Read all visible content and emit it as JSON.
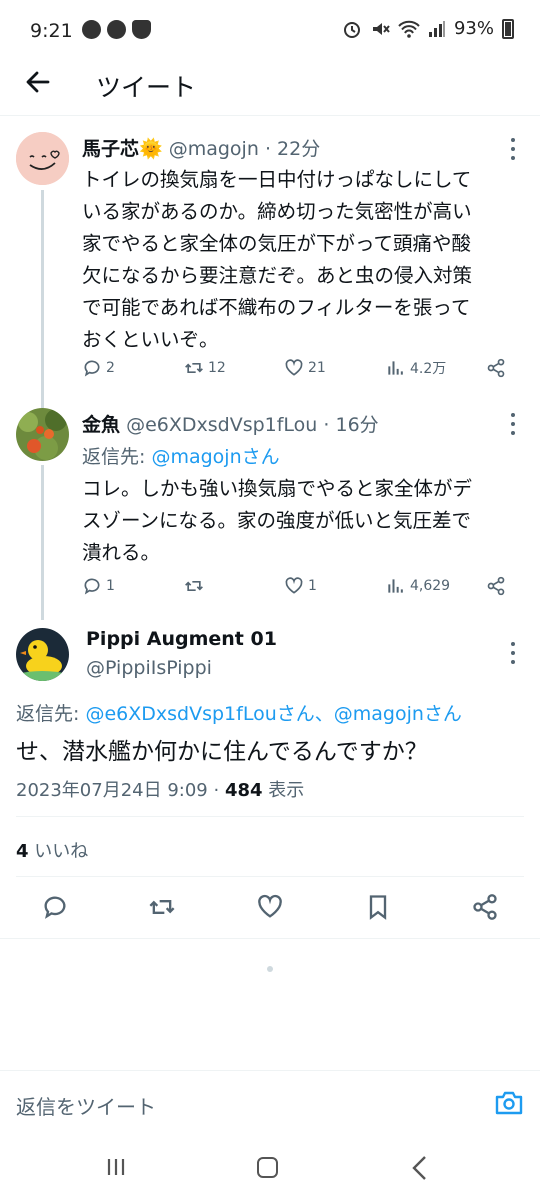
{
  "status_bar": {
    "time": "9:21",
    "battery": "93%"
  },
  "header": {
    "title": "ツイート"
  },
  "tweets": [
    {
      "name": "馬子芯🌞",
      "handle": "@magojn",
      "time": "22分",
      "body_lines": [
        "トイレの換気扇を一日中付けっぱなしにして",
        "いる家があるのか。締め切った気密性が高い",
        "家でやると家全体の気圧が下がって頭痛や酸",
        "欠になるから要注意だぞ。あと虫の侵入対策",
        "で可能であれば不織布のフィルターを張って",
        "おくといいぞ。"
      ],
      "replies": "2",
      "retweets": "12",
      "likes": "21",
      "views": "4.2万"
    },
    {
      "name": "金魚",
      "handle": "@e6XDxsdVsp1fLou",
      "time": "16分",
      "reply_label": "返信先:",
      "reply_target": "@magojnさん",
      "body_lines": [
        "コレ。しかも強い換気扇でやると家全体がデ",
        "スゾーンになる。家の強度が低いと気圧差で",
        "潰れる。"
      ],
      "replies": "1",
      "retweets": "",
      "likes": "1",
      "views": "4,629"
    }
  ],
  "main_tweet": {
    "name": "Pippi Augment 01",
    "handle": "@PippiIsPippi",
    "reply_label": "返信先:",
    "reply_targets": "@e6XDxsdVsp1fLouさん、@magojnさん",
    "body": "せ、潜水艦か何かに住んでるんですか？",
    "timestamp": "2023年07月24日 9:09",
    "views_count": "484",
    "views_label": "表示",
    "likes_count": "4",
    "likes_label": "いいね"
  },
  "composer": {
    "placeholder": "返信をツイート"
  },
  "colors": {
    "accent": "#1d9bf0",
    "secondary_text": "#536471",
    "thread_line": "#cfd9de"
  },
  "icons": [
    "back-arrow-icon",
    "reply-icon",
    "retweet-icon",
    "like-icon",
    "views-icon",
    "share-icon",
    "bookmark-icon",
    "camera-icon",
    "more-icon"
  ]
}
